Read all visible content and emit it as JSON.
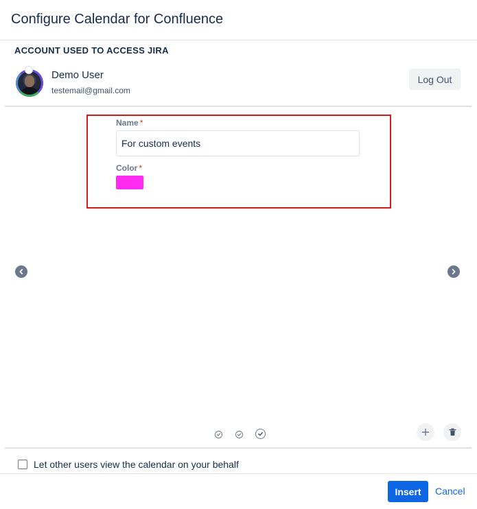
{
  "dialog": {
    "title": "Configure Calendar for Confluence"
  },
  "account": {
    "heading": "ACCOUNT USED TO ACCESS JIRA",
    "user_name": "Demo User",
    "user_email": "testemail@gmail.com",
    "logout_label": "Log Out"
  },
  "form": {
    "name_label": "Name",
    "name_value": "For custom events",
    "color_label": "Color",
    "required_marker": "*",
    "color_value": "#ff2bf0"
  },
  "navigation": {
    "prev_icon": "chevron-left-icon",
    "next_icon": "chevron-right-icon",
    "steps": [
      {
        "icon": "check-circle-icon",
        "active": false
      },
      {
        "icon": "check-circle-icon",
        "active": false
      },
      {
        "icon": "check-circle-icon",
        "active": true
      }
    ],
    "add_icon": "plus-icon",
    "delete_icon": "trash-icon"
  },
  "footer": {
    "checkbox_label": "Let other users view the calendar on your behalf",
    "checkbox_checked": false,
    "insert_label": "Insert",
    "cancel_label": "Cancel"
  },
  "colors": {
    "primary": "#0c66e4",
    "highlight_border": "#d51a1a",
    "required": "#de350b"
  }
}
